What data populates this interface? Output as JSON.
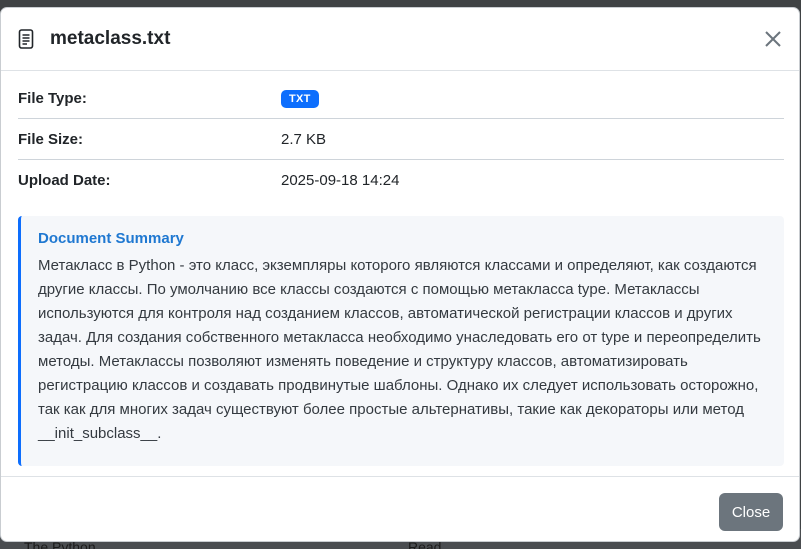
{
  "modal": {
    "title": "metaclass.txt",
    "icons": {
      "file": "file-text-icon",
      "close": "close-icon"
    },
    "close_button_label": "Close"
  },
  "info": [
    {
      "label": "File Type:",
      "value": "TXT"
    },
    {
      "label": "File Size:",
      "value": "2.7 KB"
    },
    {
      "label": "Upload Date:",
      "value": "2025-09-18 14:24"
    }
  ],
  "summary": {
    "title": "Document Summary",
    "text": "Метакласс в Python - это класс, экземпляры которого являются классами и определяют, как создаются другие классы. По умолчанию все классы создаются с помощью метакласса type. Метаклассы используются для контроля над созданием классов, автоматической регистрации классов и других задач. Для создания собственного метакласса необходимо унаследовать его от type и переопределить методы. Метаклассы позволяют изменять поведение и структуру классов, автоматизировать регистрацию классов и создавать продвинутые шаблоны. Однако их следует использовать осторожно, так как для многих задач существуют более простые альтернативы, такие как декораторы или метод __init_subclass__."
  },
  "background": {
    "left_text": "The Python",
    "right_text": "Read"
  },
  "colors": {
    "badge": "#0d6efd",
    "summary_title": "#1f78d1",
    "summary_accent": "#0d6efd",
    "close_button": "#6c757d"
  }
}
